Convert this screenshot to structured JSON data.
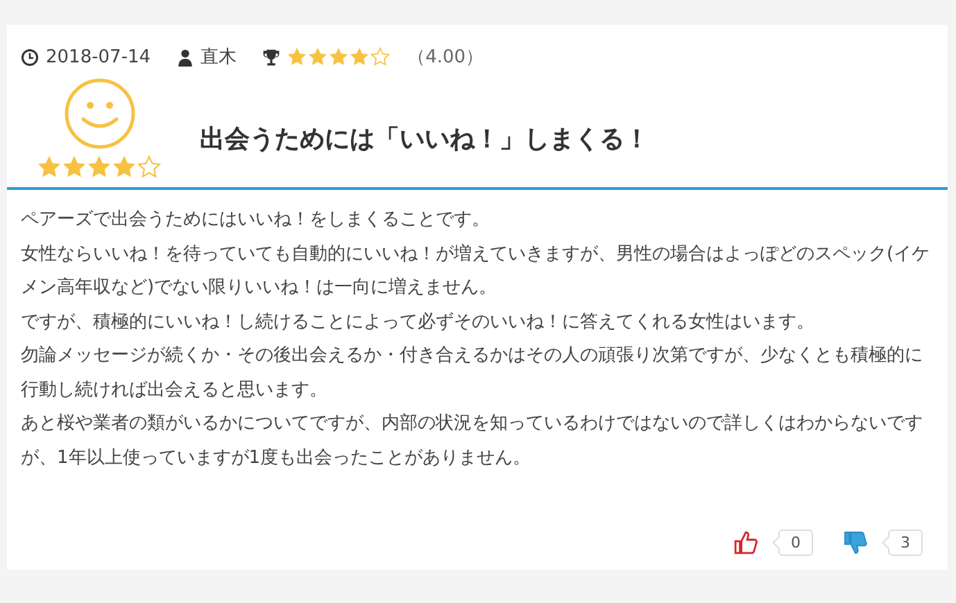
{
  "meta": {
    "date": "2018-07-14",
    "author": "直木",
    "rating": {
      "stars": 4,
      "score": "（4.00）"
    }
  },
  "face": {
    "stars": 4
  },
  "title": "出会うためには「いいね！」しまくる！",
  "body": [
    "ペアーズで出会うためにはいいね！をしまくることです。",
    "女性ならいいね！を待っていても自動的にいいね！が増えていきますが、男性の場合はよっぽどのスペック(イケメン高年収など)でない限りいいね！は一向に増えません。",
    "ですが、積極的にいいね！し続けることによって必ずそのいいね！に答えてくれる女性はいます。",
    "勿論メッセージが続くか・その後出会えるか・付き合えるかはその人の頑張り次第ですが、少なくとも積極的に行動し続ければ出会えると思います。",
    "あと桜や業者の類がいるかについてですが、内部の状況を知っているわけではないので詳しくはわからないですが、1年以上使っていますが1度も出会ったことがありません。"
  ],
  "votes": {
    "up": "0",
    "down": "3"
  }
}
